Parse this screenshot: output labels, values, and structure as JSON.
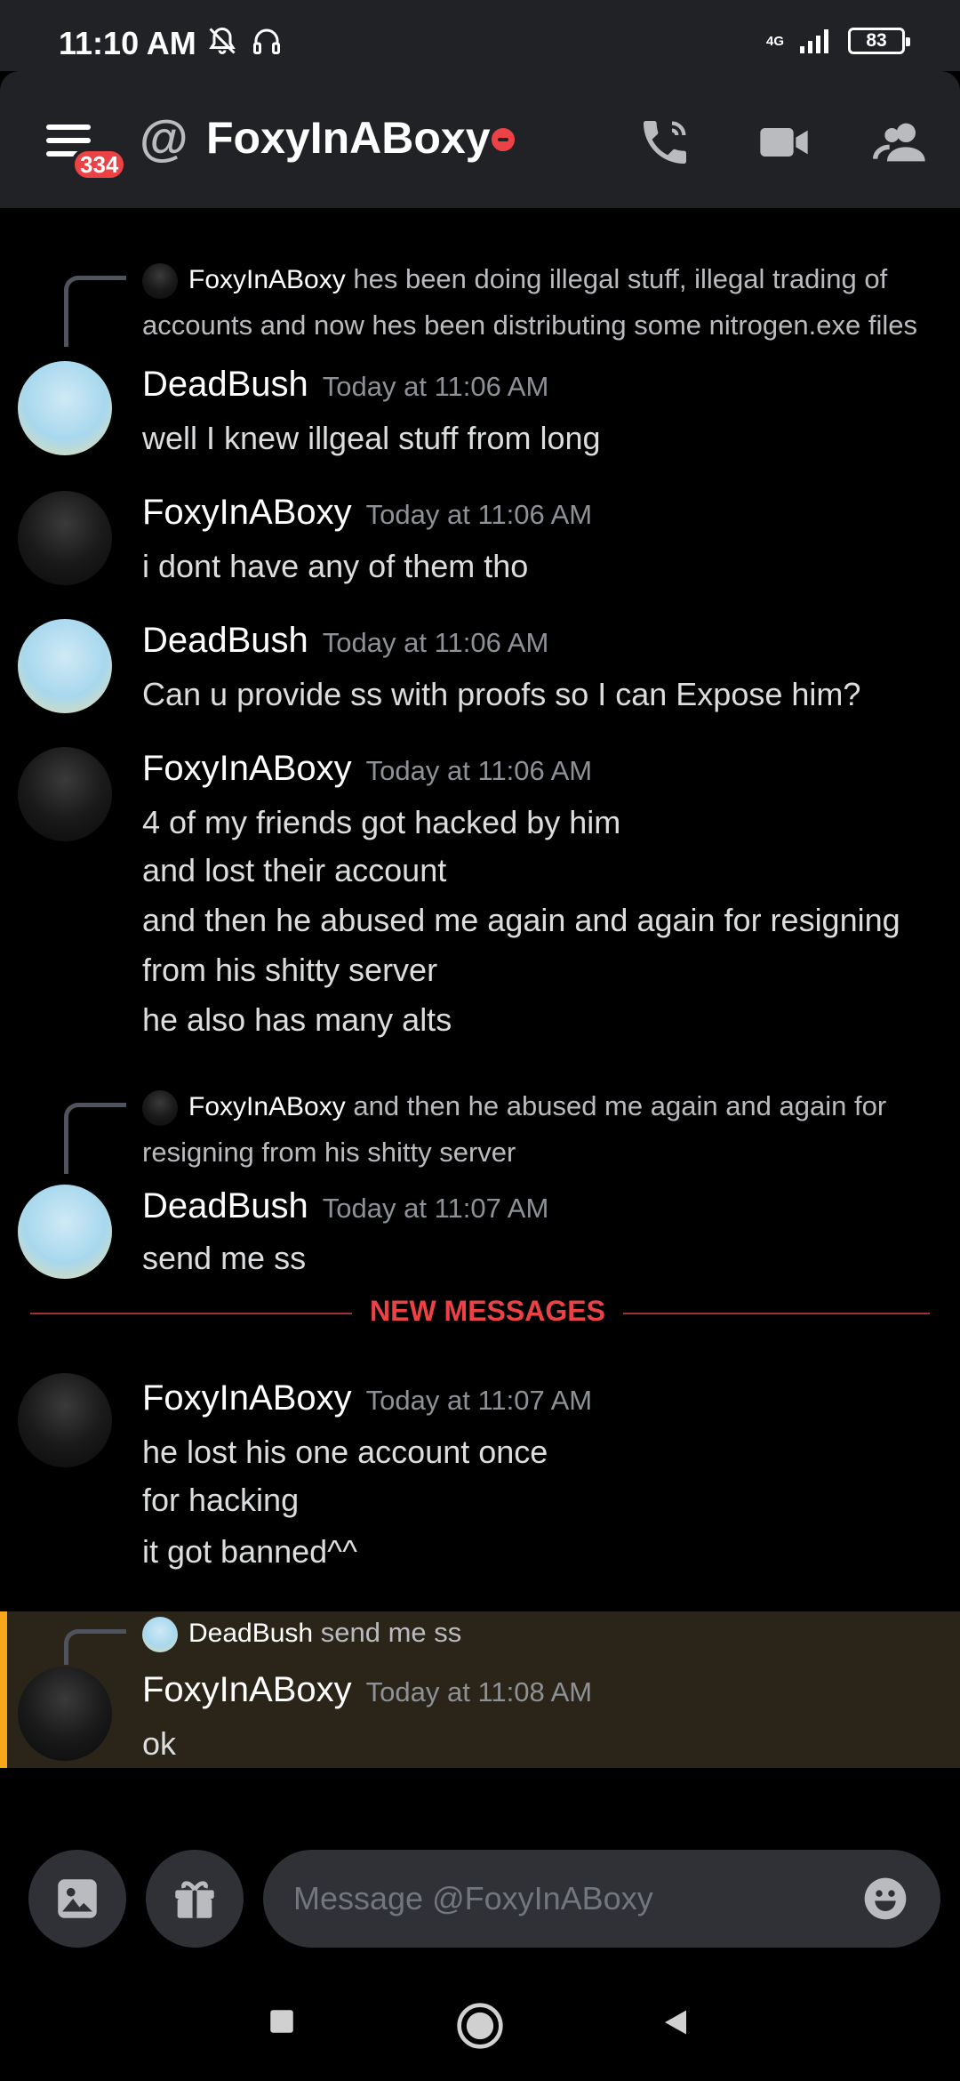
{
  "status": {
    "time": "11:10 AM",
    "network": "4G",
    "battery": "83"
  },
  "header": {
    "at_symbol": "@",
    "title": "FoxyInABoxy",
    "badge": "334"
  },
  "messages": {
    "r1": {
      "name": "FoxyInABoxy",
      "text_a": "hes been doing illegal stuff, illegal trading of",
      "text_b": "accounts and now hes been distributing some nitrogen.exe files"
    },
    "m1": {
      "name": "DeadBush",
      "time": "Today at 11:06 AM",
      "lines": [
        "well I knew illgeal stuff from long"
      ]
    },
    "m2": {
      "name": "FoxyInABoxy",
      "time": "Today at 11:06 AM",
      "lines": [
        "i dont have any of them tho"
      ]
    },
    "m3": {
      "name": "DeadBush",
      "time": "Today at 11:06 AM",
      "lines": [
        "Can u provide ss with proofs so I can Expose him?"
      ]
    },
    "m4": {
      "name": "FoxyInABoxy",
      "time": "Today at 11:06 AM",
      "lines": [
        "4 of my friends got hacked by him",
        "and lost their account",
        "and then he abused me again and again for resigning",
        "from his shitty server",
        "he also has many alts"
      ]
    },
    "r2": {
      "name": "FoxyInABoxy",
      "text_a": "and then he abused me again and again for",
      "text_b": "resigning from his shitty server"
    },
    "m5": {
      "name": "DeadBush",
      "time": "Today at 11:07 AM",
      "lines": [
        "send me ss"
      ]
    },
    "divider": "NEW MESSAGES",
    "m6": {
      "name": "FoxyInABoxy",
      "time": "Today at 11:07 AM",
      "lines": [
        "he lost his one account once",
        "for hacking",
        "it got banned^^"
      ]
    },
    "r3": {
      "name": "DeadBush",
      "text_a": "send me ss"
    },
    "m7": {
      "name": "FoxyInABoxy",
      "time": "Today at 11:08 AM",
      "lines": [
        "ok"
      ]
    }
  },
  "composer": {
    "placeholder": "Message @FoxyInABoxy"
  },
  "icons": {
    "menu": "hamburger-icon",
    "call": "phone-call-icon",
    "video": "video-camera-icon",
    "members": "members-icon",
    "image": "image-icon",
    "gift": "gift-icon",
    "emoji": "emoji-icon"
  },
  "colors": {
    "accent_red": "#ed4245",
    "mention_highlight": "#faa61a",
    "header_bg": "#202225"
  }
}
